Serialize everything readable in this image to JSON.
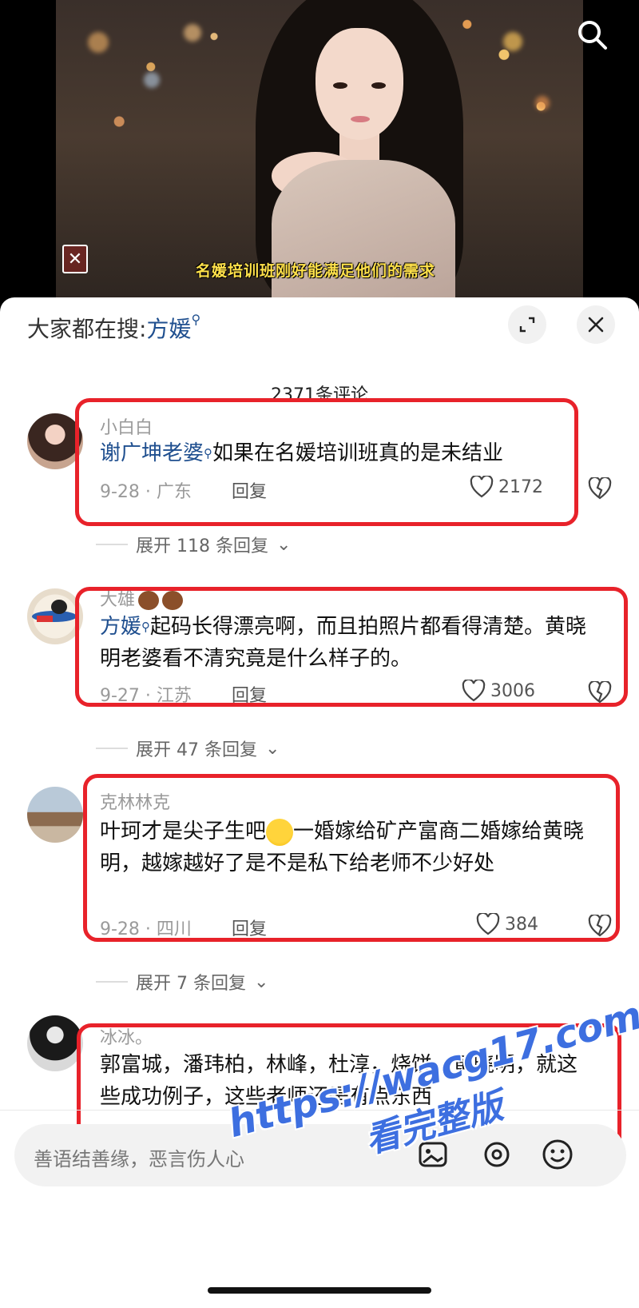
{
  "video": {
    "subtitle": "名媛培训班刚好能满足他们的需求"
  },
  "header": {
    "hot_search_prefix": "大家都在搜:",
    "hot_search_keyword": "方媛"
  },
  "comments_count": "2371条评论",
  "comments": [
    {
      "name": "小白白",
      "link": "谢广坤老婆",
      "text": "如果在名媛培训班真的是未结业",
      "meta": "9-28 · 广东",
      "reply": "回复",
      "likes": "2172",
      "expand": "展开 118 条回复"
    },
    {
      "name": "大雄",
      "link": "方媛",
      "text": "起码长得漂亮啊，而且拍照片都看得清楚。黄晓明老婆看不清究竟是什么样子的。",
      "meta": "9-27 · 江苏",
      "reply": "回复",
      "likes": "3006",
      "expand": "展开 47 条回复"
    },
    {
      "name": "克林林克",
      "text_before_emoji": "叶珂才是尖子生吧",
      "text_after_emoji": "一婚嫁给矿产富商二婚嫁给黄晓明，越嫁越好了是不是私下给老师不少好处",
      "meta": "9-28 · 四川",
      "reply": "回复",
      "likes": "384",
      "expand": "展开 7 条回复"
    },
    {
      "name": "冰冰。",
      "text": "郭富城，潘玮柏，林峰，杜淳，烧饼，黄晓明，就这些成功例子，这些老师还是有点东西"
    }
  ],
  "input": {
    "placeholder": "善语结善缘，恶言伤人心"
  },
  "watermark": {
    "line1": "https://wacg17.com",
    "line2": "看完整版"
  },
  "colors": {
    "link": "#1f4f8f",
    "highlight": "#e8222a",
    "watermark": "#3d6fe0"
  }
}
